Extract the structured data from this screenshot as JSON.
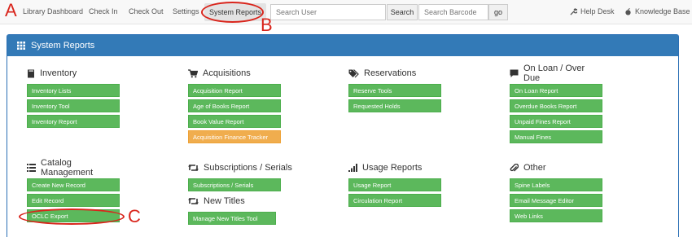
{
  "navbar": {
    "links": [
      "Library Dashboard",
      "Check In",
      "Check Out",
      "Settings"
    ],
    "active_link": "System Reports",
    "search_user_placeholder": "Search User",
    "search_button": "Search",
    "search_barcode_placeholder": "Search Barcode",
    "go_button": "go",
    "help_desk": "Help Desk",
    "knowledge_base": "Knowledge Base"
  },
  "panel": {
    "title": "System Reports",
    "sections": {
      "inventory": {
        "title": "Inventory",
        "icon": "book-icon",
        "buttons": [
          "Inventory Lists",
          "Inventory Tool",
          "Inventory Report"
        ]
      },
      "acquisitions": {
        "title": "Acquisitions",
        "icon": "shopping-cart-icon",
        "buttons": [
          "Acquisition Report",
          "Age of Books Report",
          "Book Value Report",
          "Acquisition Finance Tracker"
        ]
      },
      "reservations": {
        "title": "Reservations",
        "icon": "tags-icon",
        "buttons": [
          "Reserve Tools",
          "Requested Holds"
        ]
      },
      "on_loan": {
        "title": "On Loan / Over Due",
        "icon": "comment-icon",
        "buttons": [
          "On Loan Report",
          "Overdue Books Report",
          "Unpaid Fines Report",
          "Manual Fines"
        ]
      },
      "catalog": {
        "title": "Catalog Management",
        "icon": "list-icon",
        "buttons": [
          "Create New Record",
          "Edit Record",
          "OCLC Export"
        ]
      },
      "subscriptions": {
        "title": "Subscriptions / Serials",
        "icon": "retweet-icon",
        "buttons": [
          "Subscriptions / Serials"
        ]
      },
      "new_titles": {
        "title": "New Titles",
        "icon": "retweet-icon",
        "buttons": [
          "Manage New Titles Tool"
        ]
      },
      "usage": {
        "title": "Usage Reports",
        "icon": "signal-icon",
        "buttons": [
          "Usage Report",
          "Circulation Report"
        ]
      },
      "other": {
        "title": "Other",
        "icon": "paperclip-icon",
        "buttons": [
          "Spine Labels",
          "Email Message Editor",
          "Web Links"
        ]
      }
    }
  },
  "colors": {
    "primary": "#337ab7",
    "success": "#5cb85c",
    "warning": "#f0ad4e",
    "annotation": "#d9251c"
  },
  "annotations": {
    "a": "A",
    "b": "B",
    "c": "C"
  }
}
